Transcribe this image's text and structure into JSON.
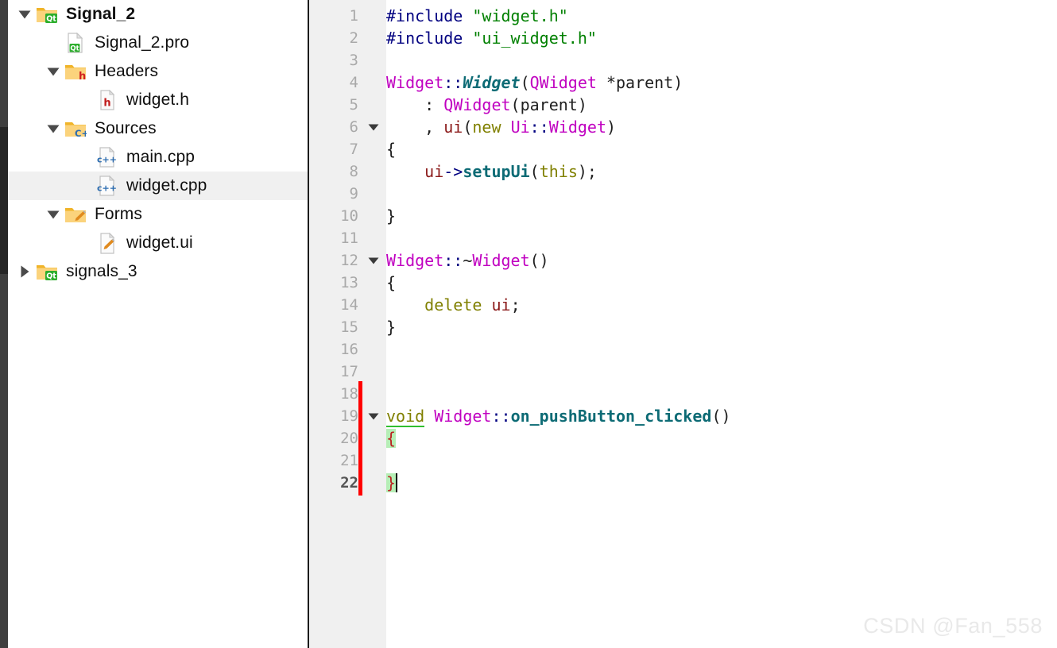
{
  "sidebar": {
    "items": [
      {
        "label": "Signal_2",
        "icon": "folder-qt-icon",
        "indent": 0,
        "twisty": "down",
        "bold": true,
        "selected": false
      },
      {
        "label": "Signal_2.pro",
        "icon": "file-qt-icon",
        "indent": 1,
        "twisty": "none",
        "bold": false,
        "selected": false
      },
      {
        "label": "Headers",
        "icon": "folder-h-icon",
        "indent": 1,
        "twisty": "down",
        "bold": false,
        "selected": false
      },
      {
        "label": "widget.h",
        "icon": "file-h-icon",
        "indent": 2,
        "twisty": "none",
        "bold": false,
        "selected": false
      },
      {
        "label": "Sources",
        "icon": "folder-cpp-icon",
        "indent": 1,
        "twisty": "down",
        "bold": false,
        "selected": false
      },
      {
        "label": "main.cpp",
        "icon": "file-cpp-icon",
        "indent": 2,
        "twisty": "none",
        "bold": false,
        "selected": false
      },
      {
        "label": "widget.cpp",
        "icon": "file-cpp-icon",
        "indent": 2,
        "twisty": "none",
        "bold": false,
        "selected": true
      },
      {
        "label": "Forms",
        "icon": "folder-form-icon",
        "indent": 1,
        "twisty": "down",
        "bold": false,
        "selected": false
      },
      {
        "label": "widget.ui",
        "icon": "file-form-icon",
        "indent": 2,
        "twisty": "none",
        "bold": false,
        "selected": false
      },
      {
        "label": "signals_3",
        "icon": "folder-qt-icon",
        "indent": 0,
        "twisty": "right",
        "bold": false,
        "selected": false
      }
    ]
  },
  "editor": {
    "line_numbers": [
      "1",
      "2",
      "3",
      "4",
      "5",
      "6",
      "7",
      "8",
      "9",
      "10",
      "11",
      "12",
      "13",
      "14",
      "15",
      "16",
      "17",
      "18",
      "19",
      "20",
      "21",
      "22"
    ],
    "current_line": 22,
    "fold_markers": [
      6,
      12,
      19
    ],
    "change_bar_lines": [
      18,
      19,
      20,
      21,
      22
    ],
    "lines": [
      {
        "n": 1,
        "text": "#include \"widget.h\""
      },
      {
        "n": 2,
        "text": "#include \"ui_widget.h\""
      },
      {
        "n": 3,
        "text": ""
      },
      {
        "n": 4,
        "text": "Widget::Widget(QWidget *parent)"
      },
      {
        "n": 5,
        "text": "    : QWidget(parent)"
      },
      {
        "n": 6,
        "text": "    , ui(new Ui::Widget)"
      },
      {
        "n": 7,
        "text": "{"
      },
      {
        "n": 8,
        "text": "    ui->setupUi(this);"
      },
      {
        "n": 9,
        "text": ""
      },
      {
        "n": 10,
        "text": "}"
      },
      {
        "n": 11,
        "text": ""
      },
      {
        "n": 12,
        "text": "Widget::~Widget()"
      },
      {
        "n": 13,
        "text": "{"
      },
      {
        "n": 14,
        "text": "    delete ui;"
      },
      {
        "n": 15,
        "text": "}"
      },
      {
        "n": 16,
        "text": ""
      },
      {
        "n": 17,
        "text": ""
      },
      {
        "n": 18,
        "text": ""
      },
      {
        "n": 19,
        "text": "void Widget::on_pushButton_clicked()"
      },
      {
        "n": 20,
        "text": "{"
      },
      {
        "n": 21,
        "text": ""
      },
      {
        "n": 22,
        "text": "}"
      }
    ]
  },
  "watermark": {
    "text": "CSDN @Fan_558"
  },
  "colors": {
    "preprocessor": "#000080",
    "string": "#008000",
    "type": "#c000c0",
    "function": "#0d6b75",
    "keyword": "#808000",
    "member": "#8b1a1a",
    "brace_highlight_bg": "#b6eeb6",
    "brace_highlight_fg": "#bb2222",
    "change_bar": "#ff0000",
    "gutter_bg": "#f0f0f0",
    "selection_bg": "#f0f0f0"
  }
}
